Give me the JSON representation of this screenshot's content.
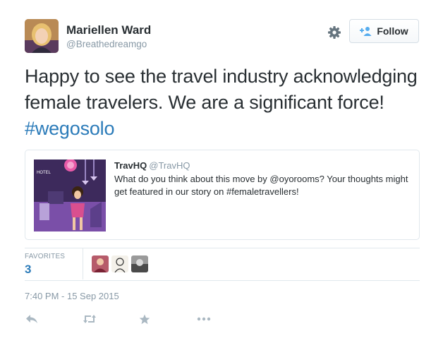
{
  "author": {
    "name": "Mariellen Ward",
    "handle": "@Breathedreamgo"
  },
  "follow_button": {
    "label": "Follow"
  },
  "tweet": {
    "text": "Happy to see the travel industry acknowledging female travelers. We are a significant force! ",
    "hashtag": "#wegosolo"
  },
  "quoted": {
    "name": "TravHQ",
    "handle": "@TravHQ",
    "text": "What do you think about this move by @oyorooms? Your thoughts might get featured in our story on #femaletravellers!",
    "image_label": "HOTEL"
  },
  "stats": {
    "label": "FAVORITES",
    "count": "3"
  },
  "timestamp": "7:40 PM - 15 Sep 2015",
  "icons": {
    "settings": "gear-icon",
    "follow": "add-user-icon",
    "reply": "reply-icon",
    "retweet": "retweet-icon",
    "favorite": "star-icon",
    "more": "more-icon"
  },
  "colors": {
    "link": "#2b7bb9",
    "muted": "#8899a6",
    "text": "#292f33",
    "border": "#e1e8ed"
  }
}
